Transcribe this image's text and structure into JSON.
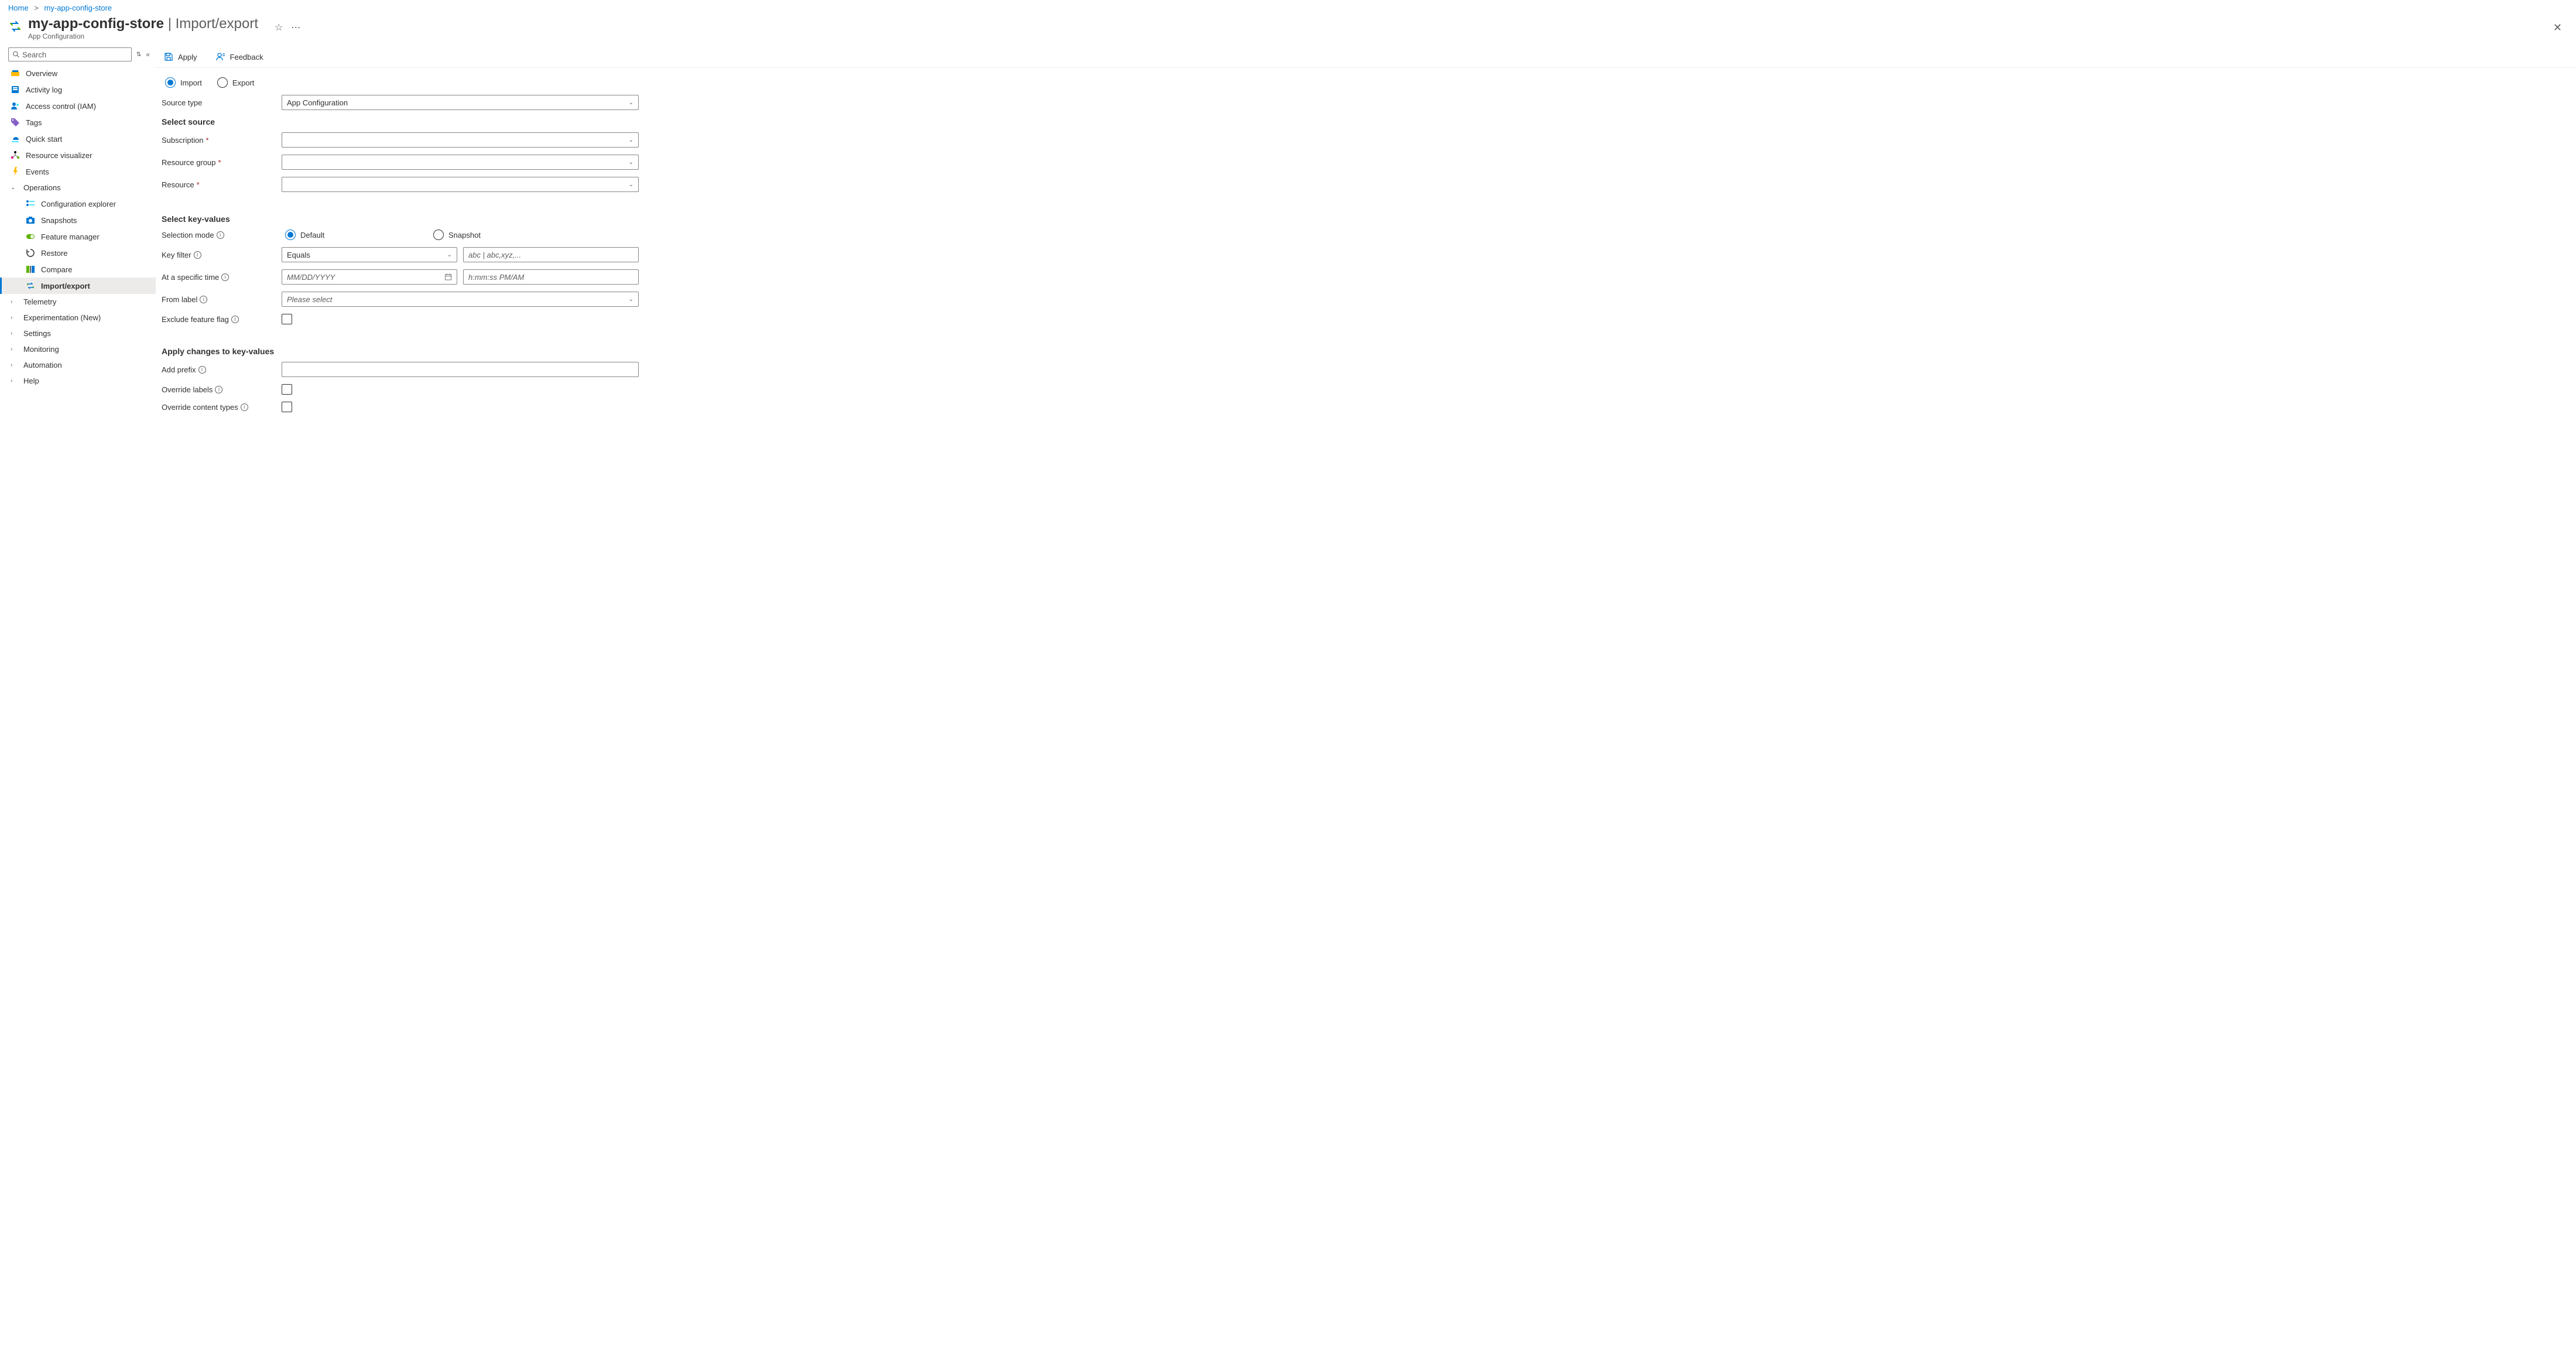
{
  "breadcrumb": {
    "home": "Home",
    "resource": "my-app-config-store"
  },
  "header": {
    "title": "my-app-config-store",
    "section": "Import/export",
    "subtitle": "App Configuration"
  },
  "sidebar": {
    "search_placeholder": "Search",
    "items": {
      "overview": "Overview",
      "activity_log": "Activity log",
      "iam": "Access control (IAM)",
      "tags": "Tags",
      "quick_start": "Quick start",
      "resource_visualizer": "Resource visualizer",
      "events": "Events",
      "operations": "Operations",
      "config_explorer": "Configuration explorer",
      "snapshots": "Snapshots",
      "feature_manager": "Feature manager",
      "restore": "Restore",
      "compare": "Compare",
      "import_export": "Import/export",
      "telemetry": "Telemetry",
      "experimentation": "Experimentation (New)",
      "settings": "Settings",
      "monitoring": "Monitoring",
      "automation": "Automation",
      "help": "Help"
    }
  },
  "commands": {
    "apply": "Apply",
    "feedback": "Feedback"
  },
  "form": {
    "mode": {
      "import": "Import",
      "export": "Export"
    },
    "source_type_label": "Source type",
    "source_type_value": "App Configuration",
    "select_source_title": "Select source",
    "subscription_label": "Subscription",
    "resource_group_label": "Resource group",
    "resource_label": "Resource",
    "select_kv_title": "Select key-values",
    "selection_mode_label": "Selection mode",
    "selection_default": "Default",
    "selection_snapshot": "Snapshot",
    "key_filter_label": "Key filter",
    "key_filter_op": "Equals",
    "key_filter_placeholder": "abc | abc,xyz,...",
    "at_time_label": "At a specific time",
    "date_placeholder": "MM/DD/YYYY",
    "time_placeholder": "h:mm:ss PM/AM",
    "from_label_label": "From label",
    "from_label_placeholder": "Please select",
    "exclude_ff_label": "Exclude feature flag",
    "apply_changes_title": "Apply changes to key-values",
    "add_prefix_label": "Add prefix",
    "override_labels_label": "Override labels",
    "override_ct_label": "Override content types"
  }
}
